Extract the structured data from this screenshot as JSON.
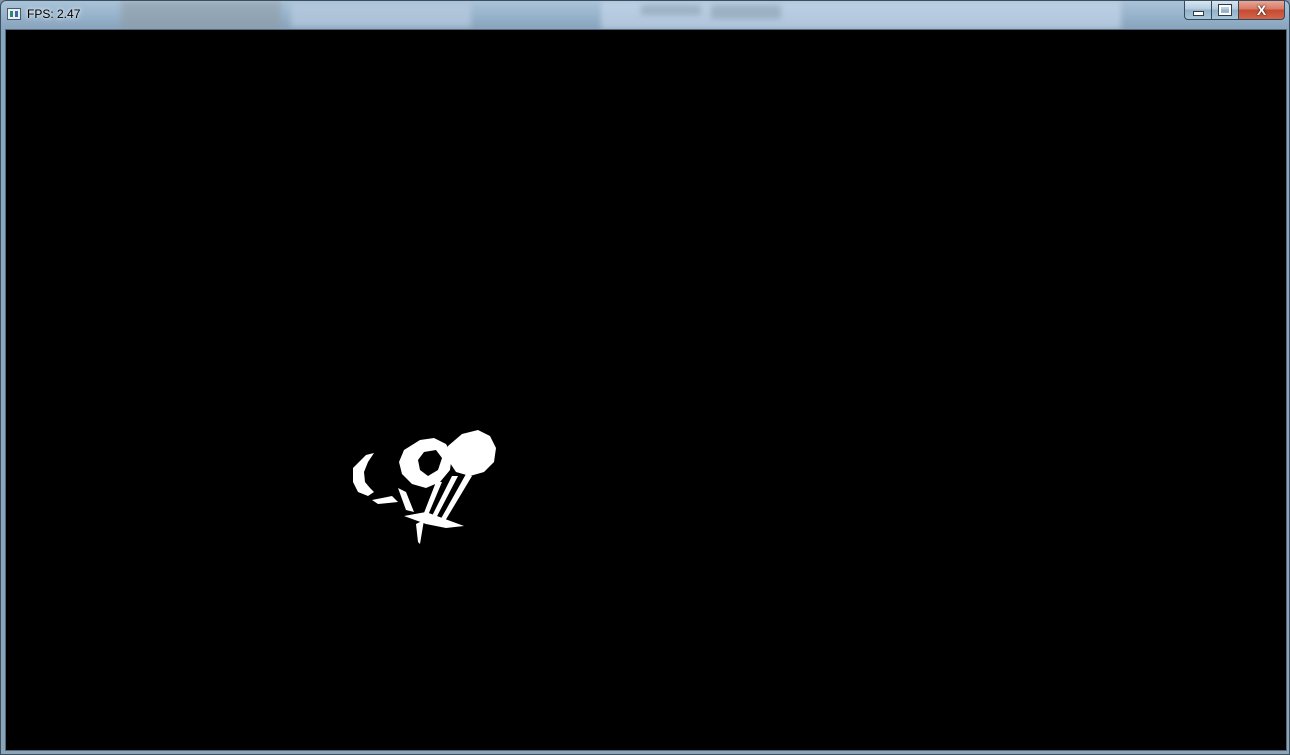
{
  "window": {
    "title": "FPS: 2.47",
    "icon": "app-window-icon",
    "controls": {
      "minimize_icon": "minimize-icon",
      "maximize_icon": "maximize-icon",
      "close_icon": "close-icon",
      "close_glyph": "X"
    }
  },
  "viewport": {
    "background_color": "#000000",
    "object_color": "#ffffff"
  }
}
